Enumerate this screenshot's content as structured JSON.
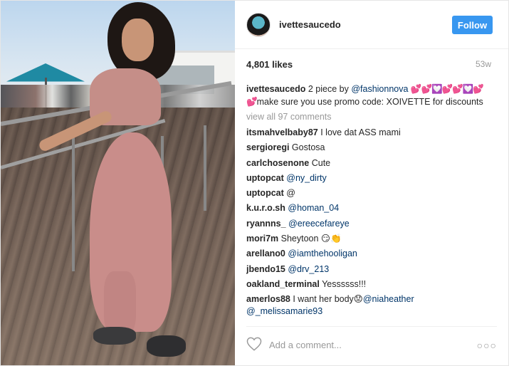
{
  "post": {
    "username": "ivettesaucedo",
    "follow_label": "Follow",
    "likes": "4,801 likes",
    "age": "53w",
    "caption": {
      "user": "ivettesaucedo",
      "text_before": "2 piece by ",
      "mention": "@fashionnova",
      "emoji": "💕💕💟💕💕💟💕💕",
      "text_after": "make sure you use promo code: XOIVETTE for discounts"
    },
    "view_all": "view all 97 comments",
    "comments": [
      {
        "user": "itsmahvelbaby87",
        "text": "I love dat ASS mami",
        "mention": ""
      },
      {
        "user": "sergioregi",
        "text": "Gostosa",
        "mention": ""
      },
      {
        "user": "carlchosenone",
        "text": "Cute",
        "mention": ""
      },
      {
        "user": "uptopcat",
        "text": "",
        "mention": "@ny_dirty"
      },
      {
        "user": "uptopcat",
        "text": "@",
        "mention": ""
      },
      {
        "user": "k.u.r.o.sh",
        "text": "",
        "mention": "@homan_04"
      },
      {
        "user": "ryannns_",
        "text": "",
        "mention": "@ereecefareye"
      },
      {
        "user": "mori7m",
        "text": "Sheytoon 😏👏",
        "mention": ""
      },
      {
        "user": "arellano0",
        "text": "",
        "mention": "@iamthehooligan"
      },
      {
        "user": "jbendo15",
        "text": "",
        "mention": "@drv_213"
      },
      {
        "user": "oakland_terminal",
        "text": "Yessssss!!!",
        "mention": ""
      },
      {
        "user": "amerlos88",
        "text": "I want her body😟",
        "mention": "@niaheather"
      }
    ],
    "last_comment_continuation": "@_melissamarie93",
    "add_comment_placeholder": "Add a comment...",
    "more_options": "○○○"
  },
  "icons": {
    "heart": "heart-outline-icon",
    "more": "more-options-icon"
  },
  "colors": {
    "follow_bg": "#3897f0",
    "mention": "#003569",
    "muted": "#999999"
  }
}
